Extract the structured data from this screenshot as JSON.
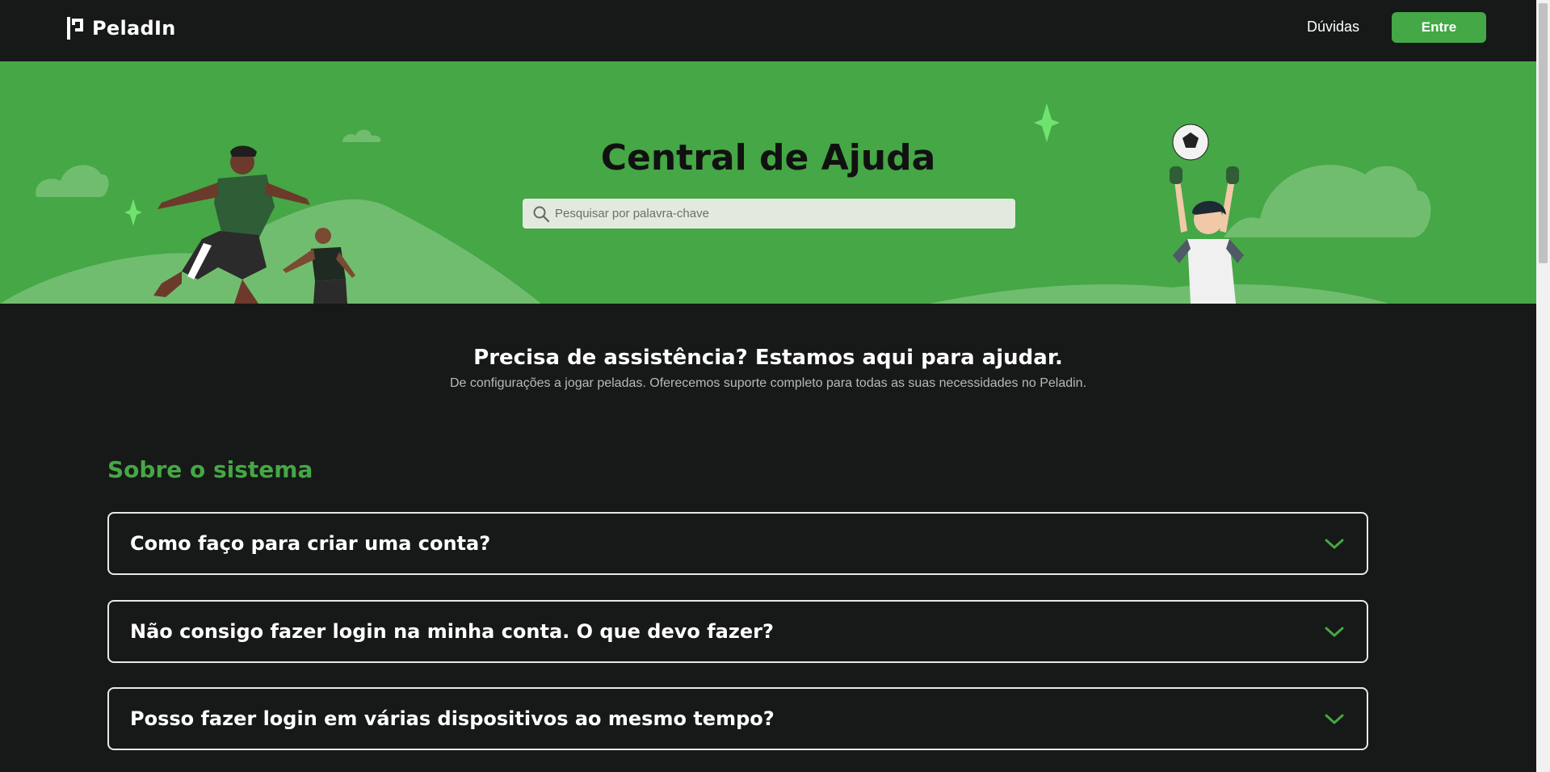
{
  "navbar": {
    "logo_text": "PeladIn",
    "faq_link": "Dúvidas",
    "login_button": "Entre"
  },
  "hero": {
    "title": "Central de Ajuda",
    "search_placeholder": "Pesquisar por palavra-chave"
  },
  "intro": {
    "title": "Precisa de assistência? Estamos aqui para ajudar.",
    "subtitle": "De configurações a jogar peladas. Oferecemos suporte completo para todas as suas necessidades no Peladin."
  },
  "faq": {
    "section_title": "Sobre o sistema",
    "items": [
      {
        "question": "Como faço para criar uma conta?"
      },
      {
        "question": "Não consigo fazer login na minha conta. O que devo fazer?"
      },
      {
        "question": "Posso fazer login em várias dispositivos ao mesmo tempo?"
      }
    ]
  },
  "colors": {
    "brand_green": "#45a745",
    "background": "#171818",
    "button_green": "#43a845"
  },
  "icons": [
    "logo-icon",
    "search-icon",
    "chevron-down-icon"
  ]
}
